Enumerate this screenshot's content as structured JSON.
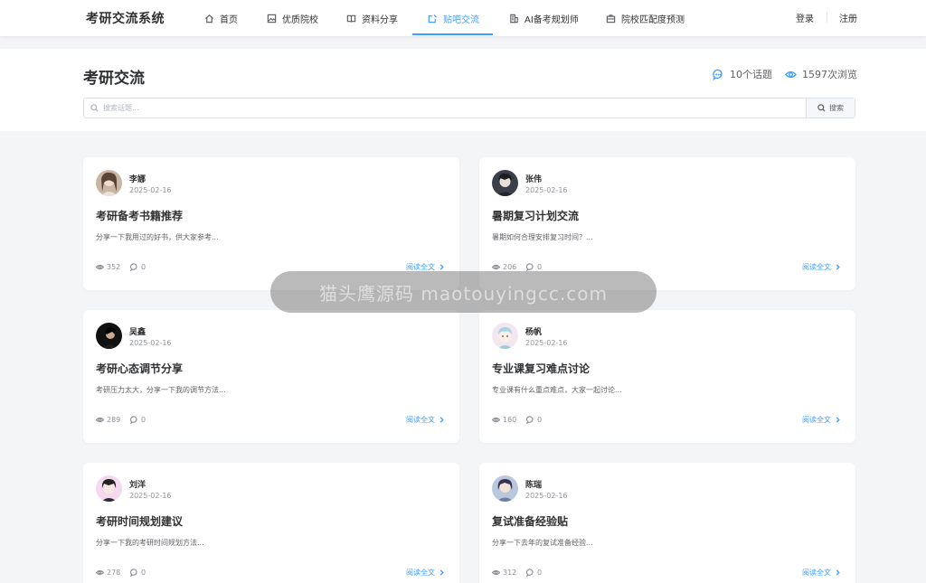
{
  "nav": {
    "brand": "考研交流系统",
    "items": [
      {
        "label": "首页",
        "icon": "home-icon"
      },
      {
        "label": "优质院校",
        "icon": "image-icon"
      },
      {
        "label": "资料分享",
        "icon": "book-icon"
      },
      {
        "label": "贴吧交流",
        "icon": "edit-square-icon",
        "active": true
      },
      {
        "label": "AI备考规划师",
        "icon": "building-icon"
      },
      {
        "label": "院校匹配度预测",
        "icon": "briefcase-icon"
      }
    ],
    "login": "登录",
    "register": "注册",
    "accent_color": "#409eff"
  },
  "header": {
    "title": "考研交流",
    "topics": "10个话题",
    "views": "1597次浏览"
  },
  "search": {
    "placeholder": "搜索话题...",
    "button": "搜索"
  },
  "posts": [
    {
      "author": "李娜",
      "date": "2025-02-16",
      "title": "考研备考书籍推荐",
      "excerpt": "分享一下我用过的好书，供大家参考...",
      "views": "352",
      "comments": "0",
      "readmore": "阅读全文"
    },
    {
      "author": "张伟",
      "date": "2025-02-16",
      "title": "暑期复习计划交流",
      "excerpt": "暑期如何合理安排复习时间？...",
      "views": "206",
      "comments": "0",
      "readmore": "阅读全文"
    },
    {
      "author": "吴鑫",
      "date": "2025-02-16",
      "title": "考研心态调节分享",
      "excerpt": "考研压力太大，分享一下我的调节方法...",
      "views": "289",
      "comments": "0",
      "readmore": "阅读全文"
    },
    {
      "author": "杨帆",
      "date": "2025-02-16",
      "title": "专业课复习难点讨论",
      "excerpt": "专业课有什么重点难点，大家一起讨论...",
      "views": "160",
      "comments": "0",
      "readmore": "阅读全文"
    },
    {
      "author": "刘洋",
      "date": "2025-02-16",
      "title": "考研时间规划建议",
      "excerpt": "分享一下我的考研时间规划方法...",
      "views": "278",
      "comments": "0",
      "readmore": "阅读全文"
    },
    {
      "author": "陈瑞",
      "date": "2025-02-16",
      "title": "复试准备经验贴",
      "excerpt": "分享一下去年的复试准备经验...",
      "views": "312",
      "comments": "0",
      "readmore": "阅读全文"
    }
  ],
  "watermark": "猫头鹰源码 maotouyingcc.com"
}
